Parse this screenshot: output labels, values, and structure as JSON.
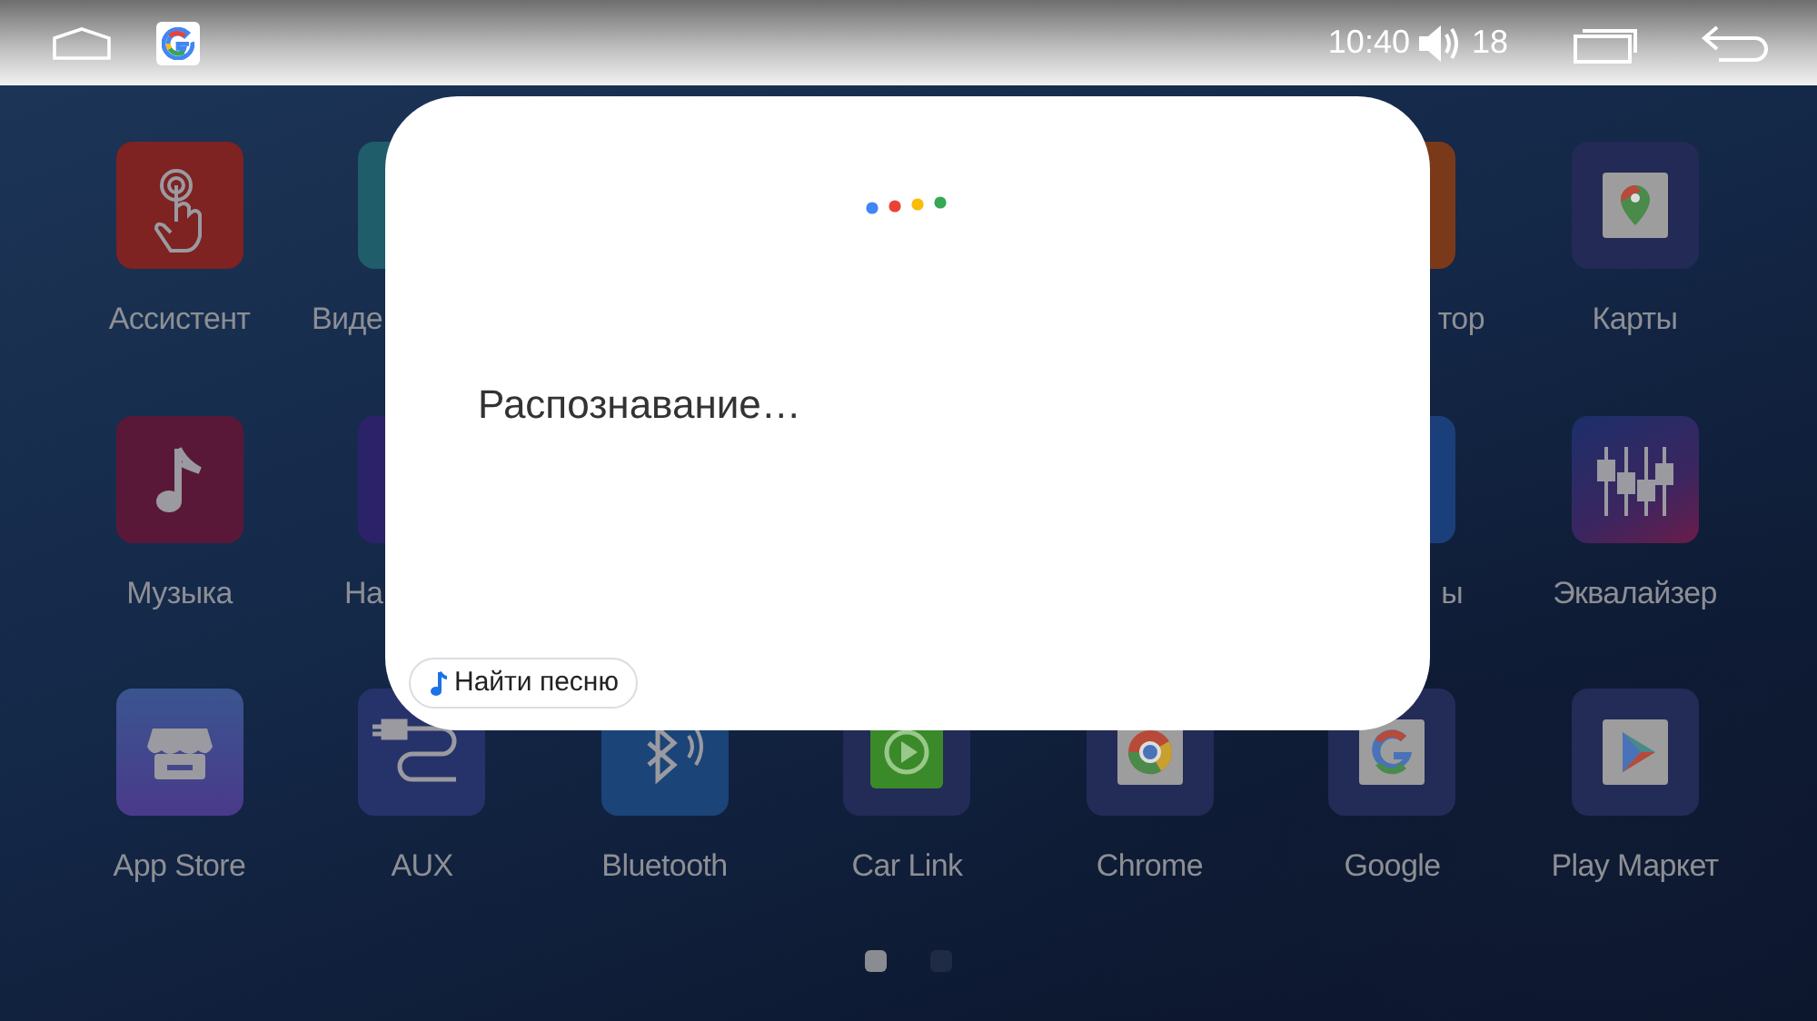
{
  "status_bar": {
    "time": "10:40",
    "volume": "18"
  },
  "app_rows": [
    {
      "apps": [
        {
          "label": "Ассистент"
        },
        {
          "label": "Виде"
        },
        {
          "label": "тор"
        },
        {
          "label": "Карты"
        }
      ]
    },
    {
      "apps": [
        {
          "label": "Музыка"
        },
        {
          "label": "На"
        },
        {
          "label": "ы"
        },
        {
          "label": "Эквалайзер"
        }
      ]
    },
    {
      "apps": [
        {
          "label": "App Store"
        },
        {
          "label": "AUX"
        },
        {
          "label": "Bluetooth"
        },
        {
          "label": "Car Link"
        },
        {
          "label": "Chrome"
        },
        {
          "label": "Google"
        },
        {
          "label": "Play Маркет"
        }
      ]
    }
  ],
  "page_dots": [
    {
      "selected": true
    },
    {
      "selected": false
    }
  ],
  "dialog": {
    "status": "Распознавание…",
    "chip": "Найти песню"
  }
}
